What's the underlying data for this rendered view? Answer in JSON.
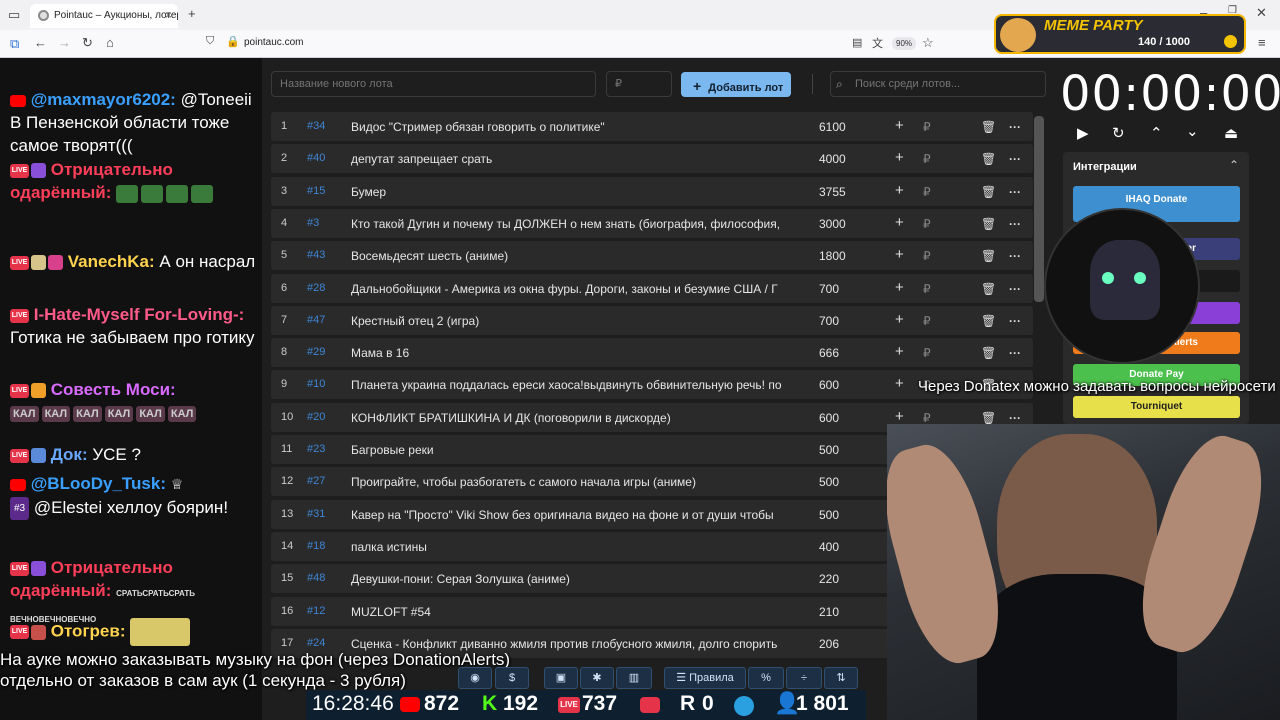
{
  "browser": {
    "tab_title": "Pointauc – Аукционы, лотереи",
    "url": "pointauc.com",
    "zoom": "90%"
  },
  "meme_party": {
    "title": "MEME PARTY",
    "count": "140 / 1000"
  },
  "chat": [
    {
      "nick": "@maxmayor6202:",
      "nick_color": "#3aa0ff",
      "text": "@Toneeii В Пензенской области тоже самое творят(((",
      "platform": "youtube"
    },
    {
      "nick": "Отрицательно одарённый:",
      "nick_color": "#ff3e5a",
      "text": "",
      "platform": "live"
    },
    {
      "nick": "VanechKa:",
      "nick_color": "#ffd34d",
      "text": "А он насрал",
      "platform": "live"
    },
    {
      "nick": "I-Hate-Myself For-Loving-:",
      "nick_color": "#ff5a8a",
      "text": "Готика не забываем про готику",
      "platform": "live"
    },
    {
      "nick": "Совесть Моси:",
      "nick_color": "#d86aff",
      "text": "",
      "platform": "live"
    },
    {
      "nick": "Док:",
      "nick_color": "#6aa8ff",
      "text": "УСЕ ?",
      "platform": "live"
    },
    {
      "nick": "@BLooDy_Tusk:",
      "nick_color": "#3aa0ff",
      "text": "@Elestei хеллоу боярин!",
      "platform": "youtube",
      "rank": "#3"
    },
    {
      "nick": "Отрицательно одарённый:",
      "nick_color": "#ff3e5a",
      "text": "",
      "platform": "live"
    },
    {
      "nick": "Отогрев:",
      "nick_color": "#ffd34d",
      "text": "",
      "platform": "live"
    }
  ],
  "emote_texts": {
    "kal": "КАЛ",
    "srat": "СРАТЬ",
    "vechno": "ВЕЧНО"
  },
  "toolbar": {
    "new_lot_placeholder": "Название нового лота",
    "price_placeholder": "₽",
    "add_label": "Добавить лот",
    "search_placeholder": "Поиск среди лотов..."
  },
  "lots": [
    {
      "n": "1",
      "id": "#34",
      "name": "Видос \"Стример обязан говорить о политике\"",
      "amount": "6100"
    },
    {
      "n": "2",
      "id": "#40",
      "name": "депутат запрещает срать",
      "amount": "4000"
    },
    {
      "n": "3",
      "id": "#15",
      "name": "Бумер",
      "amount": "3755"
    },
    {
      "n": "4",
      "id": "#3",
      "name": "Кто такой Дугин и почему ты ДОЛЖЕН о нем знать (биография, философия,",
      "amount": "3000"
    },
    {
      "n": "5",
      "id": "#43",
      "name": "Восемьдесят шесть (аниме)",
      "amount": "1800"
    },
    {
      "n": "6",
      "id": "#28",
      "name": "Дальнобойщики - Америка из окна фуры. Дороги, законы и безумие США / Г",
      "amount": "700"
    },
    {
      "n": "7",
      "id": "#47",
      "name": "Крестный отец 2 (игра)",
      "amount": "700"
    },
    {
      "n": "8",
      "id": "#29",
      "name": "Мама в 16",
      "amount": "666"
    },
    {
      "n": "9",
      "id": "#10",
      "name": "Планета украина поддалась ереси хаоса!выдвинуть обвинительную речь! по",
      "amount": "600"
    },
    {
      "n": "10",
      "id": "#20",
      "name": "КОНФЛИКТ БРАТИШКИНА И ДК (поговорили в дискорде)",
      "amount": "600"
    },
    {
      "n": "11",
      "id": "#23",
      "name": "Багровые реки",
      "amount": "500"
    },
    {
      "n": "12",
      "id": "#27",
      "name": "Проиграйте, чтобы разбогатеть с самого начала игры (аниме)",
      "amount": "500"
    },
    {
      "n": "13",
      "id": "#31",
      "name": "Кавер на \"Просто\" Viki Show без оригинала видео на фоне и от души чтобы",
      "amount": "500"
    },
    {
      "n": "14",
      "id": "#18",
      "name": "палка истины",
      "amount": "400"
    },
    {
      "n": "15",
      "id": "#48",
      "name": "Девушки-пони: Серая Золушка (аниме)",
      "amount": "220"
    },
    {
      "n": "16",
      "id": "#12",
      "name": "MUZLOFT #54",
      "amount": "210"
    },
    {
      "n": "17",
      "id": "#24",
      "name": "Сценка - Конфликт диванно жмиля против глобусного жмиля, долго спорить",
      "amount": "206"
    }
  ],
  "row_icons": {
    "plus": "+",
    "rub": "₽",
    "del": "🗑",
    "more": "···"
  },
  "timer": {
    "value": "00:00:00"
  },
  "integrations": {
    "title": "Интеграции",
    "buttons": [
      {
        "label": "IHAQ Donate",
        "color": "#3d8fcf"
      },
      {
        "label": "er",
        "color": "#3a3f7a"
      },
      {
        "label": "",
        "color": "#1a1a1a"
      },
      {
        "label": "",
        "color": "#8a3fd6"
      },
      {
        "label": "Alerts",
        "color": "#f07b1a"
      },
      {
        "label": "Donate Pay",
        "color": "#4cc04c"
      },
      {
        "label": "Tourniquet",
        "color": "#e8e04a"
      }
    ]
  },
  "overlay": {
    "donatex": "Через Donatex можно задавать вопросы нейросети",
    "music1": "На ауке можно заказывать музыку на фон (через DonationAlerts)",
    "music2": "отдельно от заказов в сам аук (1 секунда - 3 рубля)"
  },
  "bottom_toolbar": {
    "rules": "Правила",
    "percent": "%"
  },
  "status": {
    "time": "16:28:46",
    "youtube": "872",
    "kick": "192",
    "vk": "737",
    "rutube": "0",
    "viewers": "1 801"
  }
}
